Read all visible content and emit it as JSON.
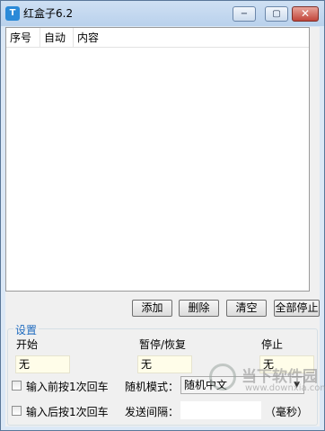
{
  "window": {
    "title": "红盒子6.2",
    "app_icon_glyph": "T",
    "controls": {
      "minimize": "−",
      "maximize": "▢",
      "close": "✕"
    }
  },
  "list": {
    "columns": [
      "序号",
      "自动",
      "内容"
    ],
    "rows": []
  },
  "buttons": {
    "add": "添加",
    "delete": "删除",
    "clear": "清空",
    "stop_all": "全部停止"
  },
  "settings": {
    "group_title": "设置",
    "start_label": "开始",
    "start_value": "无",
    "pause_label": "暂停/恢复",
    "pause_value": "无",
    "stop_label": "停止",
    "stop_value": "无",
    "enter_before_label": "输入前按1次回车",
    "enter_before_checked": false,
    "enter_after_label": "输入后按1次回车",
    "enter_after_checked": false,
    "random_mode_label": "随机模式：",
    "random_mode_value": "随机中文",
    "send_interval_label": "发送间隔：",
    "send_interval_value": "",
    "send_interval_unit": "（毫秒）"
  },
  "watermark": {
    "name": "当下软件园",
    "url": "www.downxia.com"
  },
  "colors": {
    "titlebar": "#c4d8ef",
    "client_bg": "#f0f0f0",
    "input_bg": "#fffde9",
    "group_title": "#1f6bbf"
  }
}
